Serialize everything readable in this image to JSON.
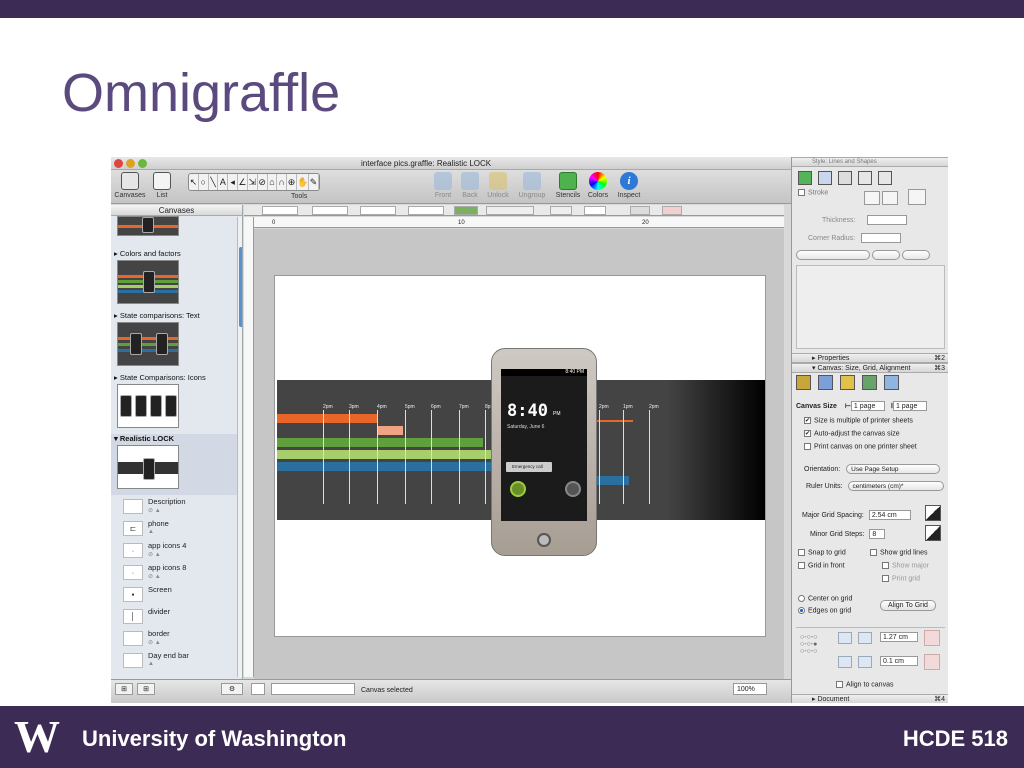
{
  "slide": {
    "title": "Omnigraffle",
    "footer_org": "University of Washington",
    "footer_logo": "W",
    "footer_course": "HCDE 518"
  },
  "window": {
    "title": "interface pics.graffle: Realistic LOCK",
    "toolbar": {
      "canvases": "Canvases",
      "list": "List",
      "tools_label": "Tools",
      "tools": [
        "↖",
        "○",
        "╲",
        "A",
        "◂",
        "∠",
        "⇲",
        "⊘",
        "⌂",
        "∩",
        "⊕",
        "✋",
        "✎"
      ],
      "front": "Front",
      "back": "Back",
      "unlock": "Unlock",
      "ungroup": "Ungroup",
      "stencils": "Stencils",
      "colors": "Colors",
      "inspect": "Inspect",
      "inspect_glyph": "i"
    },
    "sidebar": {
      "header": "Canvases",
      "canvases": [
        {
          "label": "Colors and factors"
        },
        {
          "label": "State comparisons: Text"
        },
        {
          "label": "State Comparisons: Icons"
        },
        {
          "label": "Realistic LOCK"
        }
      ],
      "layers": [
        {
          "name": "Description",
          "glyph": ""
        },
        {
          "name": "phone",
          "glyph": "⊏"
        },
        {
          "name": "app icons 4",
          "glyph": "·"
        },
        {
          "name": "app icons 8",
          "glyph": "·"
        },
        {
          "name": "Screen",
          "glyph": "▪"
        },
        {
          "name": "divider",
          "glyph": "│"
        },
        {
          "name": "border",
          "glyph": ""
        },
        {
          "name": "Day end bar",
          "glyph": ""
        }
      ]
    },
    "ruler_labels": [
      "0",
      "10",
      "20"
    ],
    "timeline_labels": [
      "2pm",
      "3pm",
      "4pm",
      "5pm",
      "6pm",
      "7pm",
      "8p",
      "11am",
      "2pm",
      "1pm",
      "2pm"
    ],
    "phone": {
      "status": "8:40 PM",
      "time": "8:40",
      "ampm": "PM",
      "date": "Saturday, June 6",
      "emergency": "Emergency call"
    },
    "status_text": "Canvas selected",
    "zoom": "100%"
  },
  "inspector": {
    "top_title": "Style: Lines and Shapes",
    "stroke_label": "Stroke",
    "thickness_label": "Thickness:",
    "corner_label": "Corner Radius:",
    "properties_label": "Properties",
    "properties_kb": "⌘2",
    "canvas_section": "Canvas: Size, Grid, Alignment",
    "canvas_kb": "⌘3",
    "canvas_size_label": "Canvas Size",
    "canvas_w": "1 page",
    "canvas_h": "1 page",
    "size_multiple": "Size is multiple of printer sheets",
    "auto_adjust": "Auto-adjust the canvas size",
    "print_one": "Print canvas on one printer sheet",
    "orientation_label": "Orientation:",
    "orientation_value": "Use Page Setup",
    "ruler_units_label": "Ruler Units:",
    "ruler_units_value": "centimeters (cm)*",
    "major_grid_label": "Major Grid Spacing:",
    "major_grid_value": "2.54 cm",
    "minor_grid_label": "Minor Grid Steps:",
    "minor_grid_value": "8",
    "snap_to_grid": "Snap to grid",
    "show_grid_lines": "Show grid lines",
    "grid_in_front": "Grid in front",
    "show_major": "Show major",
    "print_grid": "Print grid",
    "center_on_grid": "Center on grid",
    "edges_on_grid": "Edges on grid",
    "align_to_grid": "Align To Grid",
    "align_val1": "1.27 cm",
    "align_val2": "0.1 cm",
    "align_to_canvas": "Align to canvas",
    "document_label": "Document",
    "document_kb": "⌘4"
  },
  "colors": {
    "brand_purple": "#3c2b55",
    "title_purple": "#5b4a7e",
    "timeline": [
      "#e8662a",
      "#f0a383",
      "#5fa03c",
      "#a6cf6b",
      "#2a6f9d"
    ]
  }
}
